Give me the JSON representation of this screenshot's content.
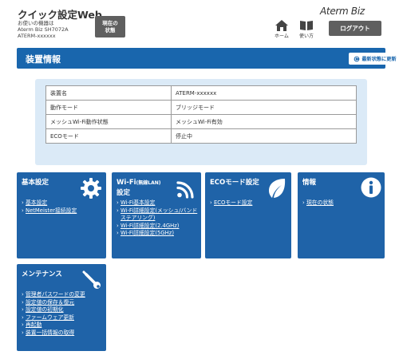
{
  "header": {
    "app_title": "クイック設定Web",
    "device_caption": "お使いの機器は",
    "device_model": "Aterm Biz SH7072A",
    "device_name": "ATERM-xxxxxx",
    "current_state_button": "現在の\n状態",
    "brand_logo": "Aterm Biz",
    "nav_home": "ホーム",
    "nav_howto": "使い方",
    "logout_button": "ログアウト"
  },
  "titlebar": {
    "title": "装置情報",
    "refresh_button": "最新状態に更新"
  },
  "device_info": {
    "rows": [
      {
        "label": "装置名",
        "value": "ATERM-xxxxxx"
      },
      {
        "label": "動作モード",
        "value": "ブリッジモード"
      },
      {
        "label": "メッシュWi-Fi動作状態",
        "value": "メッシュWi-Fi有効"
      },
      {
        "label": "ECOモード",
        "value": "停止中"
      }
    ]
  },
  "cards": {
    "basic": {
      "title": "基本設定",
      "icon": "gear-icon",
      "links": [
        "基本設定",
        "NetMeister接続設定"
      ]
    },
    "wifi": {
      "title_main": "Wi-Fi",
      "title_small": "(無線LAN)",
      "title_line2": "設定",
      "icon": "wifi-icon",
      "links": [
        "Wi-Fi基本設定",
        "Wi-Fi詳細設定(メッシュ/バンドステアリング)",
        "Wi-Fi詳細設定(2.4GHz)",
        "Wi-Fi詳細設定(5GHz)"
      ]
    },
    "eco": {
      "title": "ECOモード設定",
      "icon": "leaf-icon",
      "links": [
        "ECOモード設定"
      ]
    },
    "info": {
      "title": "情報",
      "icon": "info-icon",
      "links": [
        "現在の状態"
      ]
    },
    "maintenance": {
      "title": "メンテナンス",
      "icon": "wrench-icon",
      "links": [
        "管理者パスワードの変更",
        "設定値の保存＆復元",
        "設定値の初期化",
        "ファームウェア更新",
        "再起動",
        "装置一括情報の取得"
      ]
    }
  },
  "colors": {
    "primary_blue": "#1966ad",
    "card_blue": "#1f63a8",
    "panel_light_blue": "#dbeaf7",
    "button_gray": "#5f5f5f"
  }
}
